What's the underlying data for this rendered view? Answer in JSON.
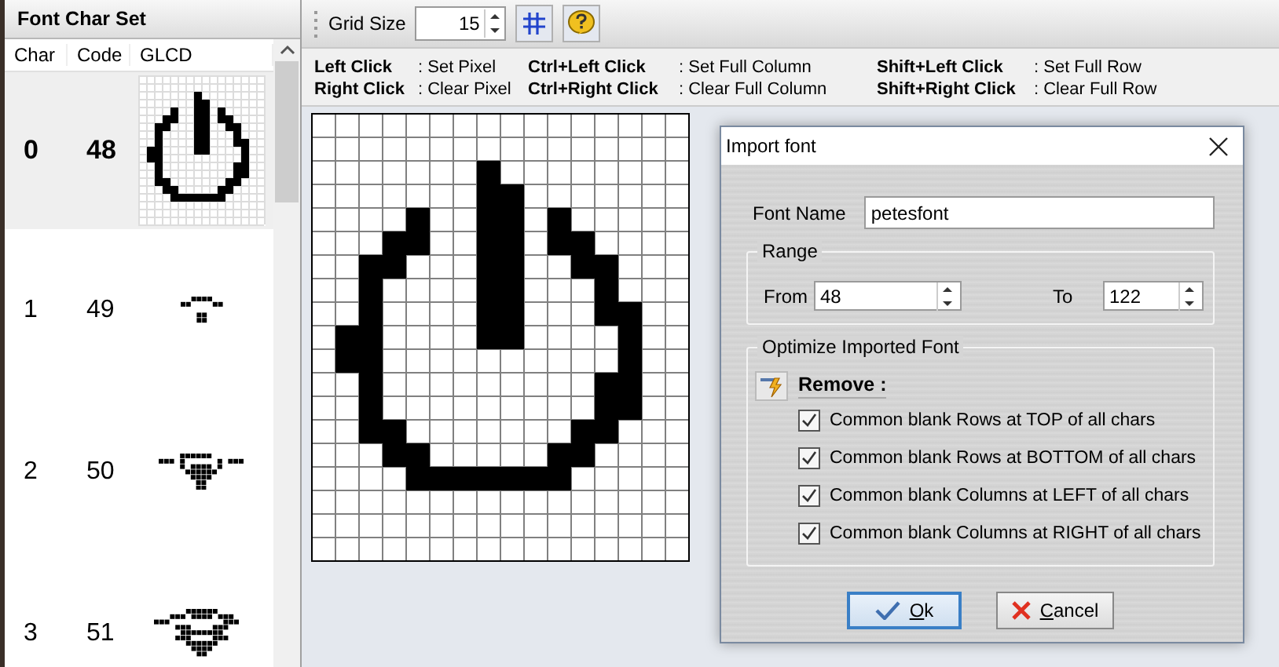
{
  "panel": {
    "title": "Font Char Set",
    "columns": [
      "Char",
      "Code",
      "GLCD"
    ],
    "rows": [
      {
        "char": "0",
        "code": "48",
        "selected": true
      },
      {
        "char": "1",
        "code": "49",
        "selected": false
      },
      {
        "char": "2",
        "code": "50",
        "selected": false
      },
      {
        "char": "3",
        "code": "51",
        "selected": false
      }
    ]
  },
  "toolbar": {
    "grid_size_label": "Grid Size",
    "grid_size": "15"
  },
  "shortcuts": [
    {
      "key": "Left Click",
      "action": ": Set Pixel"
    },
    {
      "key": "Ctrl+Left Click",
      "action": ": Set Full Column"
    },
    {
      "key": "Shift+Left Click",
      "action": ": Set Full Row"
    },
    {
      "key": "Right Click",
      "action": ": Clear Pixel"
    },
    {
      "key": "Ctrl+Right Click",
      "action": ": Clear Full Column"
    },
    {
      "key": "Shift+Right Click",
      "action": ": Clear Full Row"
    }
  ],
  "dialog": {
    "title": "Import font",
    "font_name_label": "Font Name",
    "font_name": "petesfont",
    "range": {
      "title": "Range",
      "from_label": "From",
      "from": "48",
      "to_label": "To",
      "to": "122"
    },
    "optimize": {
      "title": "Optimize Imported Font",
      "remove_label": "Remove :",
      "options": [
        {
          "label": "Common blank Rows at TOP of all chars",
          "checked": true
        },
        {
          "label": "Common blank Rows at BOTTOM of all chars",
          "checked": true
        },
        {
          "label": "Common blank Columns at LEFT of all chars",
          "checked": true
        },
        {
          "label": "Common blank Columns at RIGHT of all chars",
          "checked": true
        }
      ]
    },
    "buttons": [
      {
        "kind": "ok",
        "label": "Ok"
      },
      {
        "kind": "cancel",
        "label": "Cancel"
      }
    ]
  }
}
